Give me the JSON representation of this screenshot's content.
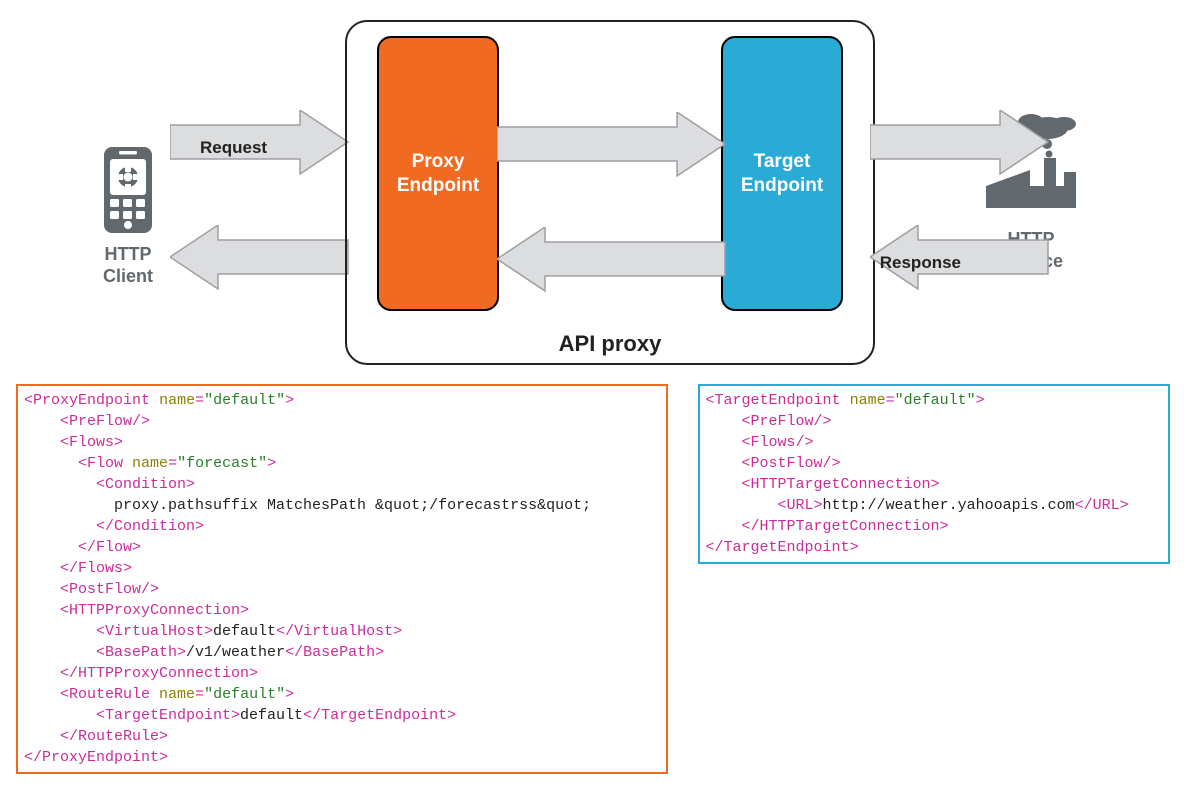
{
  "diagram": {
    "http_client_label": "HTTP\nClient",
    "http_service_label": "HTTP\nService",
    "api_proxy_label": "API proxy",
    "proxy_endpoint_label": "Proxy\nEndpoint",
    "target_endpoint_label": "Target\nEndpoint",
    "request_label": "Request",
    "response_label": "Response"
  },
  "colors": {
    "proxy_endpoint": "#f06a22",
    "target_endpoint": "#29abd6",
    "icon_gray": "#61696f",
    "arrow_fill": "#dcdddf",
    "arrow_stroke": "#9e9fa3"
  },
  "proxy_xml": {
    "root_name": "ProxyEndpoint",
    "root_attr_name": "name",
    "root_attr_value": "default",
    "flow_name": "forecast",
    "condition_text": "proxy.pathsuffix MatchesPath &quot;/forecastrss&quot;",
    "virtual_host": "default",
    "base_path": "/v1/weather",
    "route_rule_name": "default",
    "route_target": "default"
  },
  "target_xml": {
    "root_name": "TargetEndpoint",
    "root_attr_name": "name",
    "root_attr_value": "default",
    "url": "http://weather.yahooapis.com"
  }
}
